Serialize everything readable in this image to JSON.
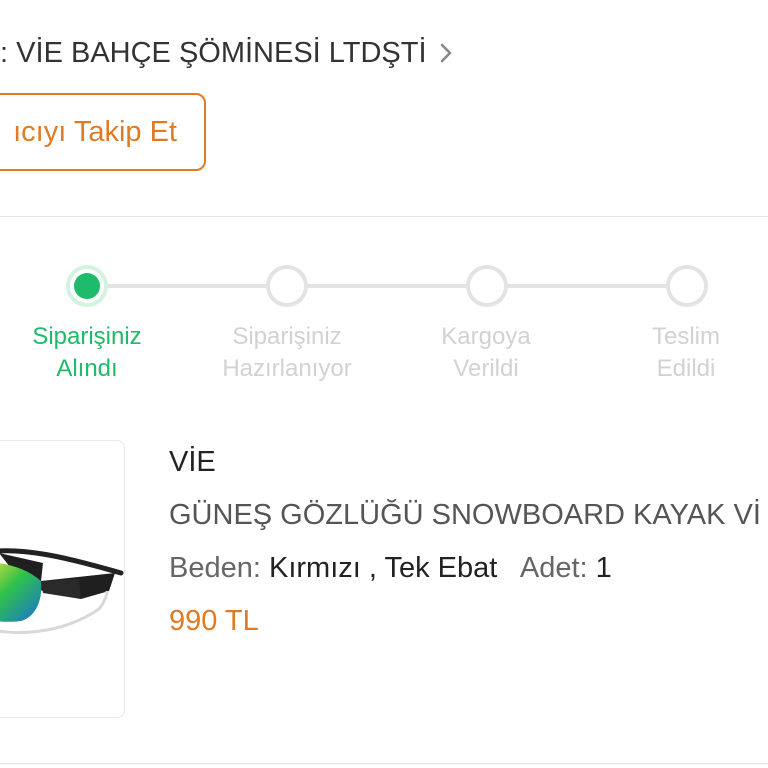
{
  "seller": {
    "line": "ı: VİE BAHÇE ŞÖMİNESİ LTDŞTİ"
  },
  "follow_button": {
    "label": "ıcıyı Takip Et"
  },
  "order_steps": [
    {
      "line1": "Siparişiniz",
      "line2": "Alındı",
      "active": true
    },
    {
      "line1": "Siparişiniz",
      "line2": "Hazırlanıyor",
      "active": false
    },
    {
      "line1": "Kargoya",
      "line2": "Verildi",
      "active": false
    },
    {
      "line1": "Teslim",
      "line2": "Edildi",
      "active": false
    }
  ],
  "product": {
    "brand": "VİE",
    "title": "GÜNEŞ GÖZLÜĞÜ SNOWBOARD KAYAK Vİ",
    "variant_label": "Beden:",
    "variant_value": "Kırmızı , Tek Ebat",
    "qty_label": "Adet:",
    "qty_value": "1",
    "price": "990 TL",
    "image": "sunglasses-image"
  },
  "colors": {
    "accent": "#e07b24",
    "success": "#1dbb6a",
    "inactive": "#d2d2d2"
  },
  "icons": {
    "seller_chevron": "chevron-right-icon"
  }
}
